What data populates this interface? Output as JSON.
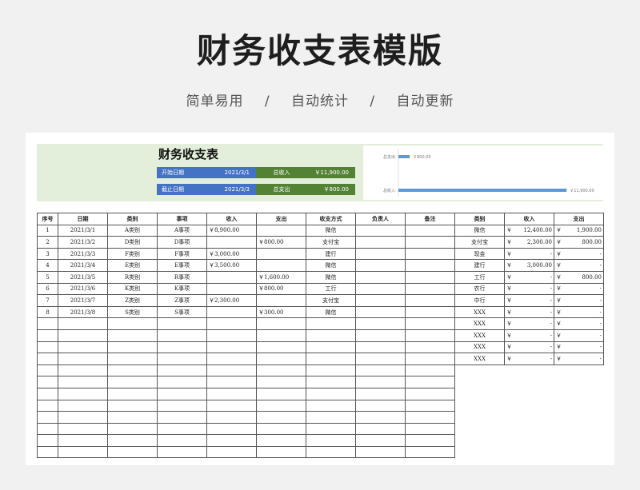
{
  "hero": {
    "title": "财务收支表模版",
    "tags": [
      "简单易用",
      "/",
      "自动统计",
      "/",
      "自动更新"
    ]
  },
  "summary": {
    "title": "财务收支表",
    "start_label": "开始日期",
    "start_value": "2021/3/1",
    "end_label": "截止日期",
    "end_value": "2021/3/3",
    "income_label": "总收入",
    "income_value": "￥11,900.00",
    "expense_label": "总支出",
    "expense_value": "￥800.00"
  },
  "chart_data": {
    "type": "bar",
    "orientation": "horizontal",
    "categories": [
      "总支出",
      "总收入"
    ],
    "values": [
      800,
      11900
    ],
    "data_labels": [
      "￥800.00",
      "￥11,900.00"
    ],
    "xlim": [
      0,
      12000
    ],
    "grid": false,
    "bar_color": "#5b9bd5"
  },
  "main_table": {
    "headers": [
      "序号",
      "日期",
      "类别",
      "事项",
      "收入",
      "支出",
      "收支方式",
      "负责人",
      "备注"
    ],
    "rows": [
      [
        "1",
        "2021/3/1",
        "A类别",
        "A事项",
        "￥8,900.00",
        "",
        "微信",
        "",
        ""
      ],
      [
        "2",
        "2021/3/2",
        "D类别",
        "D事项",
        "",
        "￥800.00",
        "支付宝",
        "",
        ""
      ],
      [
        "3",
        "2021/3/3",
        "F类别",
        "F事项",
        "￥3,000.00",
        "",
        "建行",
        "",
        ""
      ],
      [
        "4",
        "2021/3/4",
        "E类别",
        "E事项",
        "￥3,500.00",
        "",
        "微信",
        "",
        ""
      ],
      [
        "5",
        "2021/3/5",
        "R类别",
        "R事项",
        "",
        "￥1,600.00",
        "微信",
        "",
        ""
      ],
      [
        "6",
        "2021/3/6",
        "K类别",
        "K事项",
        "",
        "￥800.00",
        "工行",
        "",
        ""
      ],
      [
        "7",
        "2021/3/7",
        "Z类别",
        "Z事项",
        "￥2,300.00",
        "",
        "支付宝",
        "",
        ""
      ],
      [
        "8",
        "2021/3/8",
        "S类别",
        "S事项",
        "",
        "￥300.00",
        "微信",
        "",
        ""
      ]
    ],
    "empty_rows": 12
  },
  "side_table": {
    "headers": [
      "类别",
      "收入",
      "支出"
    ],
    "currency": "￥",
    "rows": [
      [
        "微信",
        "12,400.00",
        "1,900.00"
      ],
      [
        "支付宝",
        "2,300.00",
        "800.00"
      ],
      [
        "现金",
        "-",
        "-"
      ],
      [
        "建行",
        "3,000.00",
        "-"
      ],
      [
        "工行",
        "-",
        "800.00"
      ],
      [
        "农行",
        "-",
        "-"
      ],
      [
        "中行",
        "-",
        "-"
      ],
      [
        "XXX",
        "-",
        "-"
      ],
      [
        "XXX",
        "-",
        "-"
      ],
      [
        "XXX",
        "-",
        "-"
      ],
      [
        "XXX",
        "-",
        "-"
      ],
      [
        "XXX",
        "-",
        "-"
      ]
    ]
  }
}
